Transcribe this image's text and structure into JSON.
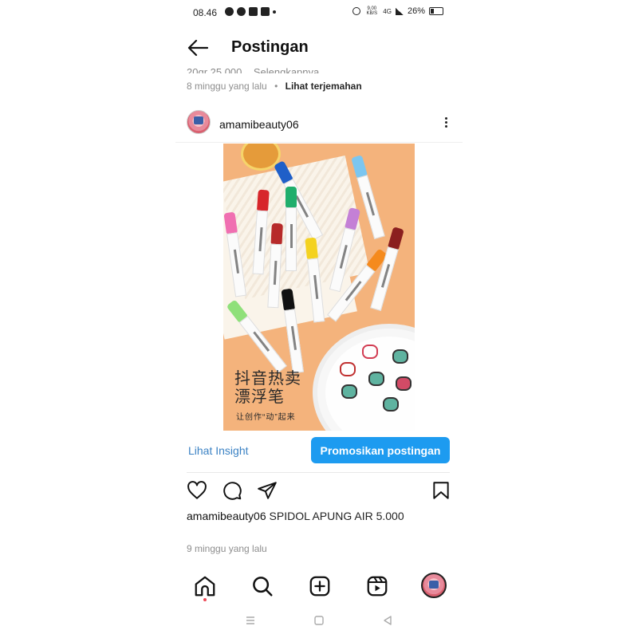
{
  "status_bar": {
    "time": "08.46",
    "net_speed": "9,00 KB/S",
    "signal_label": "4G",
    "battery": "26%"
  },
  "header": {
    "back_icon": "arrow-left-icon",
    "title": "Postingan"
  },
  "previous_post": {
    "caption_cut": "20gr 25.000... Selengkapnya",
    "time_ago": "8 minggu yang lalu",
    "separator": "•",
    "translate_label": "Lihat terjemahan"
  },
  "post": {
    "username": "amamibeauty06",
    "image": {
      "title_line1": "抖音热卖",
      "title_line2": "漂浮笔",
      "subtitle": "让创作“动”起来"
    },
    "insight_label": "Lihat Insight",
    "promote_label": "Promosikan postingan",
    "caption_user": "amamibeauty06",
    "caption_text": "SPIDOL APUNG AIR 5.000",
    "time_ago": "9 minggu yang lalu"
  },
  "icons": {
    "like": "heart-icon",
    "comment": "comment-icon",
    "share": "send-icon",
    "save": "bookmark-icon",
    "more": "more-vertical-icon"
  },
  "colors": {
    "accent": "#1d9bf0",
    "link": "#3b82c4",
    "notification": "#ed4956"
  }
}
